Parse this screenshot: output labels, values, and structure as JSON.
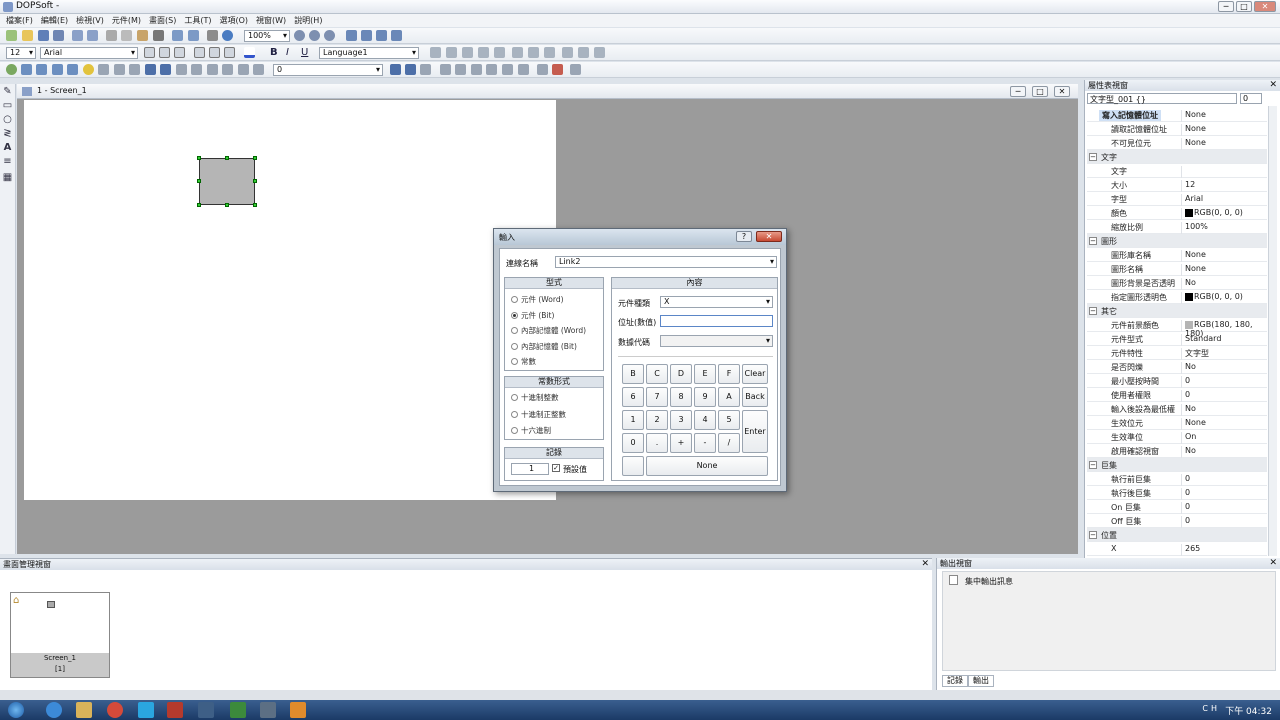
{
  "window": {
    "title": "DOPSoft -",
    "min": "─",
    "max": "□",
    "close": "✕"
  },
  "menu": [
    "檔案(F)",
    "編輯(E)",
    "檢視(V)",
    "元件(M)",
    "畫面(S)",
    "工具(T)",
    "選項(O)",
    "視窗(W)",
    "說明(H)"
  ],
  "toolbar": {
    "zoom": "100%",
    "font_size": "12",
    "font_name": "Arial",
    "language": "Language1",
    "state": "0"
  },
  "screen_window": {
    "title": "1 - Screen_1"
  },
  "properties": {
    "panel_title": "屬性表視窗",
    "selected_object": "文字型_001 {}",
    "selected_index": "0",
    "rows": [
      {
        "k": "寫入記憶體位址",
        "v": "None",
        "type": "hl"
      },
      {
        "k": "讀取記憶體位址",
        "v": "None"
      },
      {
        "k": "不可見位元",
        "v": "None"
      },
      {
        "k": "文字",
        "v": "",
        "type": "cat"
      },
      {
        "k": "文字",
        "v": ""
      },
      {
        "k": "大小",
        "v": "12"
      },
      {
        "k": "字型",
        "v": "Arial"
      },
      {
        "k": "顏色",
        "v": "RGB(0, 0, 0)",
        "swatch": "#000000"
      },
      {
        "k": "縮放比例",
        "v": "100%"
      },
      {
        "k": "圖形",
        "v": "",
        "type": "cat"
      },
      {
        "k": "圖形庫名稱",
        "v": "None"
      },
      {
        "k": "圖形名稱",
        "v": "None"
      },
      {
        "k": "圖形背景是否透明",
        "v": "No"
      },
      {
        "k": "指定圖形透明色",
        "v": "RGB(0, 0, 0)",
        "swatch": "#000000"
      },
      {
        "k": "其它",
        "v": "",
        "type": "cat"
      },
      {
        "k": "元件前景顏色",
        "v": "RGB(180, 180, 180)",
        "swatch": "#b4b4b4"
      },
      {
        "k": "元件型式",
        "v": "Standard"
      },
      {
        "k": "元件特性",
        "v": "文字型"
      },
      {
        "k": "是否閃爍",
        "v": "No"
      },
      {
        "k": "最小壓按時間",
        "v": "0"
      },
      {
        "k": "使用者權限",
        "v": "0"
      },
      {
        "k": "輸入後設為最低權",
        "v": "No"
      },
      {
        "k": "生效位元",
        "v": "None"
      },
      {
        "k": "生效準位",
        "v": "On"
      },
      {
        "k": "啟用確認視窗",
        "v": "No"
      },
      {
        "k": "巨集",
        "v": "",
        "type": "cat"
      },
      {
        "k": "執行前巨集",
        "v": "0"
      },
      {
        "k": "執行後巨集",
        "v": "0"
      },
      {
        "k": "On 巨集",
        "v": "0"
      },
      {
        "k": "Off 巨集",
        "v": "0"
      },
      {
        "k": "位置",
        "v": "",
        "type": "cat"
      },
      {
        "k": "X",
        "v": "265"
      }
    ]
  },
  "screen_manager": {
    "title": "畫面管理視窗",
    "thumb_label": "Screen_1",
    "thumb_index": "[1]"
  },
  "output": {
    "title": "輸出視窗",
    "item": "集中輸出訊息",
    "tab1": "記錄",
    "tab2": "輸出"
  },
  "dialog": {
    "title": "輸入",
    "help": "?",
    "close": "✕",
    "link_label": "連線名稱",
    "link_value": "Link2",
    "type_group": "型式",
    "type_options": [
      "元件 (Word)",
      "元件 (Bit)",
      "內部記憶體 (Word)",
      "內部記憶體 (Bit)",
      "常數"
    ],
    "type_selected": 1,
    "constant_group": "常數形式",
    "constant_options": [
      "十進制整數",
      "十進制正整數",
      "十六進制"
    ],
    "record_group": "記錄",
    "record_value": "1",
    "default_label": "預設值",
    "content_group": "內容",
    "device_type_label": "元件種類",
    "device_type_value": "X",
    "address_label": "位址(數值)",
    "address_value": "",
    "data_code_label": "數據代碼",
    "data_code_value": "",
    "keys": [
      [
        "B",
        "C",
        "D",
        "E",
        "F"
      ],
      [
        "6",
        "7",
        "8",
        "9",
        "A"
      ],
      [
        "1",
        "2",
        "3",
        "4",
        "5"
      ],
      [
        "0",
        ".",
        "+",
        "-",
        "/"
      ]
    ],
    "clear": "Clear",
    "back": "Back",
    "enter": "Enter",
    "none": "None"
  },
  "taskbar": {
    "time": "下午 04:32",
    "tray": "CH"
  },
  "colors": {
    "canvas_gray": "#9b9b9b",
    "shape_fill": "#b5b5b5",
    "taskbar": "#1b3a66"
  }
}
